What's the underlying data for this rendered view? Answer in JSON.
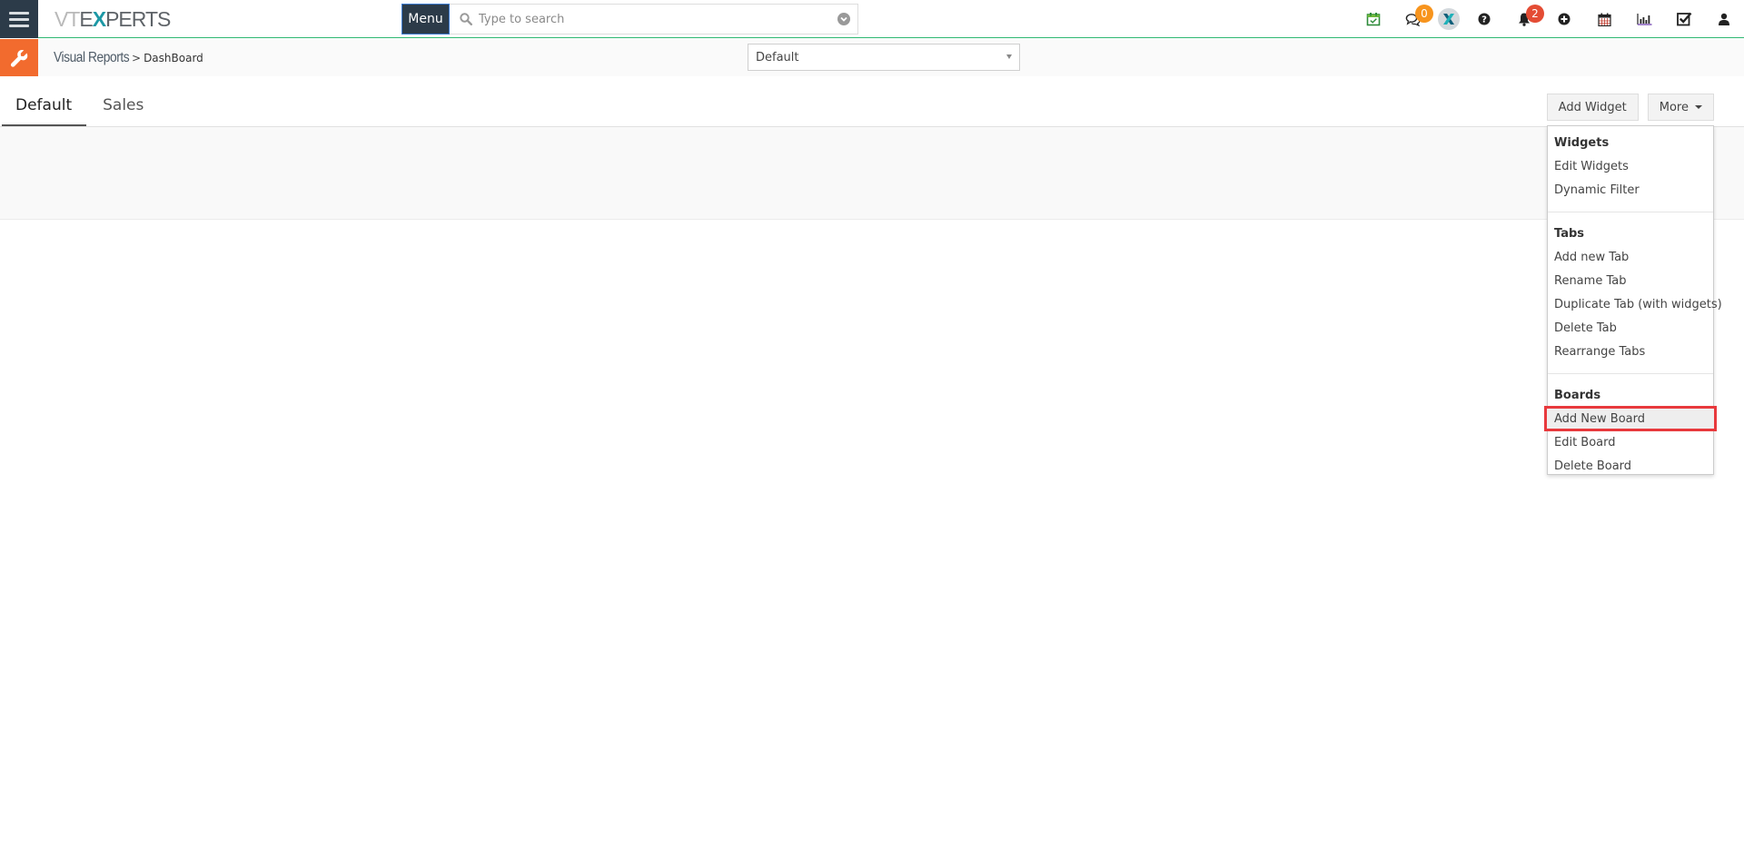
{
  "header": {
    "logo": {
      "part1": "VT",
      "part2": "E",
      "part3": "X",
      "part4": "PERTS"
    },
    "menu_label": "Menu",
    "search": {
      "placeholder": "Type to search",
      "value": ""
    },
    "icons": [
      {
        "name": "calendar-check-icon",
        "color": "#2e8b3a"
      },
      {
        "name": "chat-icon",
        "badge": "0",
        "badge_color": "#f7941d"
      },
      {
        "name": "vtexperts-x-icon"
      },
      {
        "name": "help-icon"
      },
      {
        "name": "notifications-bell-icon",
        "badge": "2",
        "badge_color": "#e44c34"
      },
      {
        "name": "quick-create-plus-icon"
      },
      {
        "name": "calendar-icon"
      },
      {
        "name": "reports-chart-icon"
      },
      {
        "name": "tasks-checkbox-icon"
      },
      {
        "name": "user-profile-icon"
      }
    ]
  },
  "module_bar": {
    "module_name": "Visual Reports",
    "separator": ">",
    "page_name": "DashBoard",
    "board_select": {
      "selected": "Default"
    },
    "accent_color": "#f26b2e"
  },
  "tabs": [
    {
      "label": "Default",
      "active": true
    },
    {
      "label": "Sales",
      "active": false
    }
  ],
  "actions": {
    "add_widget": "Add Widget",
    "more": "More"
  },
  "more_menu": {
    "sections": [
      {
        "header": "Widgets",
        "items": [
          "Edit Widgets",
          "Dynamic Filter"
        ]
      },
      {
        "header": "Tabs",
        "items": [
          "Add new Tab",
          "Rename Tab",
          "Duplicate Tab (with widgets)",
          "Delete Tab",
          "Rearrange Tabs"
        ]
      },
      {
        "header": "Boards",
        "items": [
          "Add New Board",
          "Edit Board",
          "Delete Board"
        ]
      }
    ],
    "highlighted_item": "Add New Board",
    "highlight_color": "#e8393d"
  }
}
